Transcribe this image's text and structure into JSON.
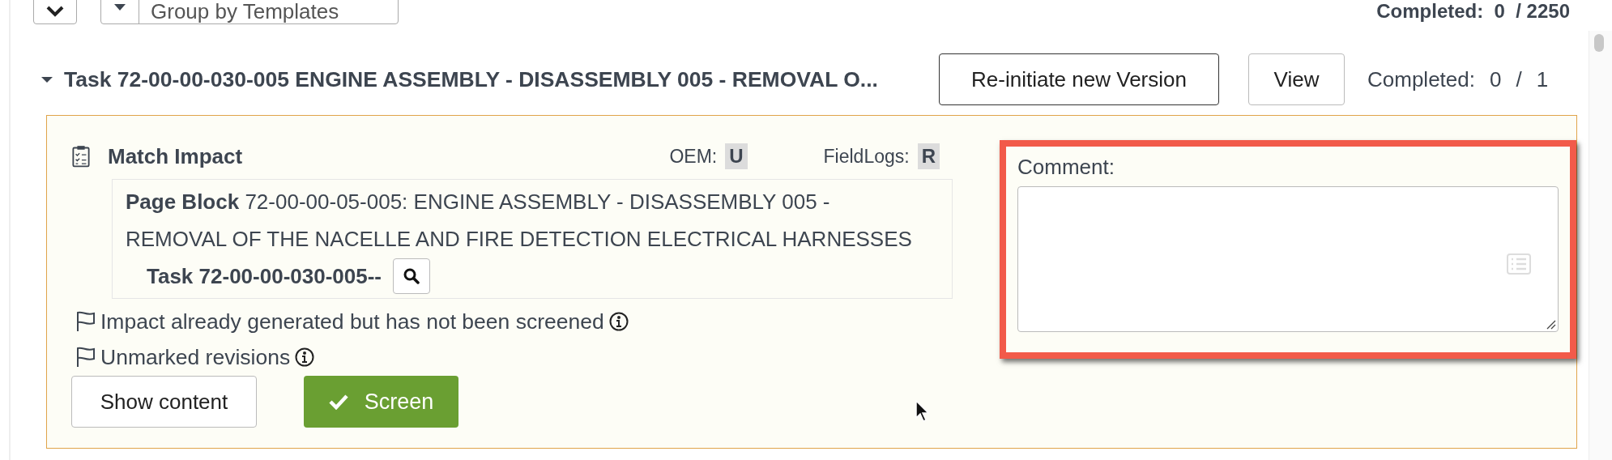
{
  "toolbar": {
    "group_by": "Group by Templates",
    "completed": {
      "label": "Completed:",
      "done": "0",
      "total": "/ 2250"
    }
  },
  "task": {
    "title": "Task 72-00-00-030-005 ENGINE ASSEMBLY - DISASSEMBLY 005 - REMOVAL O...",
    "expanded": true,
    "buttons": [
      "Re-initiate new Version",
      "View"
    ],
    "completed": {
      "label": "Completed:",
      "done": "0",
      "separator": "/",
      "total": "1"
    }
  },
  "impact": {
    "title": "Match Impact",
    "oem": {
      "label": "OEM:",
      "value": "U"
    },
    "fieldlogs": {
      "label": "FieldLogs:",
      "value": "R"
    },
    "page_block": {
      "text": "**Page Block** 72-00-00-05-005: ENGINE ASSEMBLY - DISASSEMBLY 005 - REMOVAL OF THE NACELLE AND FIRE DETECTION ELECTRICAL HARNESSES",
      "task": "Task 72-00-00-030-005--"
    },
    "flags": [
      "Impact already generated but has not been screened",
      "Unmarked revisions"
    ],
    "show_content": "Show content",
    "screen": "Screen"
  },
  "comment": {
    "label": "Comment:",
    "highlighted": true
  }
}
